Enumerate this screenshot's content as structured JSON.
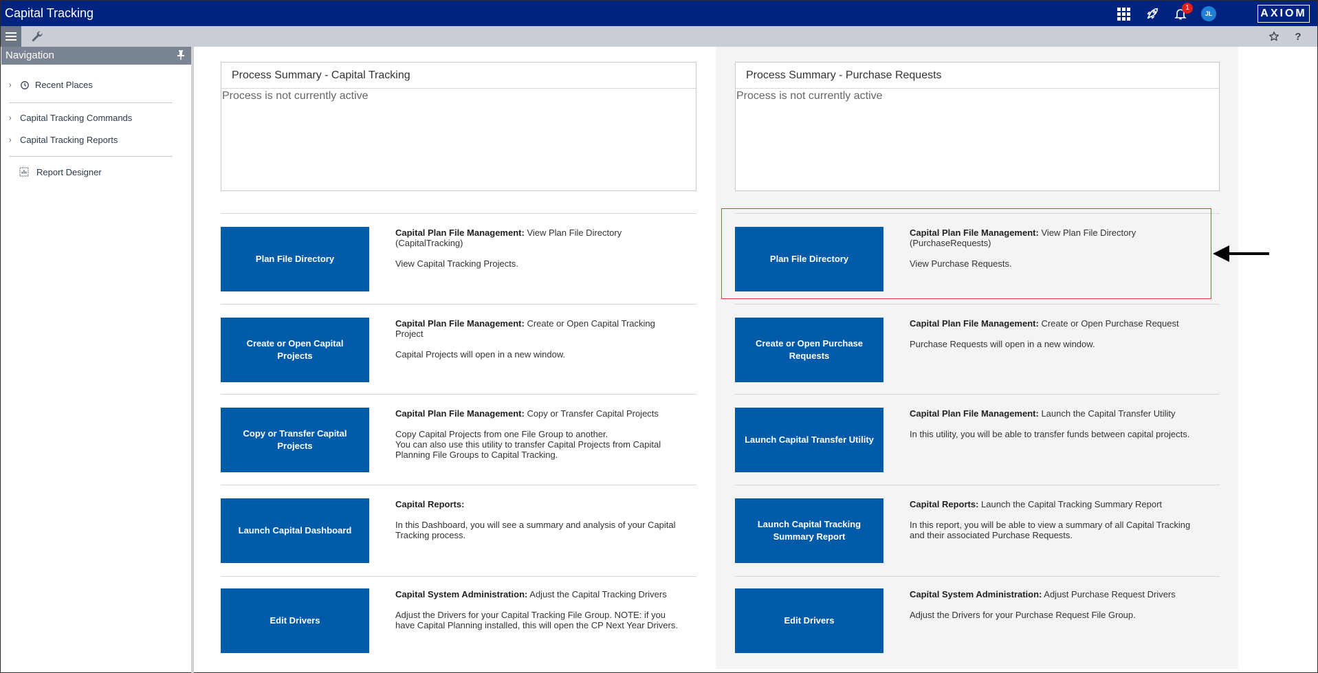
{
  "header": {
    "title": "Capital Tracking",
    "notification_count": "1",
    "avatar_initials": "JL",
    "logo": "AXIOM"
  },
  "toolbar": {
    "help_label": "?"
  },
  "sidebar": {
    "header": "Navigation",
    "items": [
      {
        "label": "Recent Places"
      },
      {
        "label": "Capital Tracking Commands"
      },
      {
        "label": "Capital Tracking Reports"
      },
      {
        "label": "Report Designer"
      }
    ]
  },
  "left": {
    "summary": {
      "title": "Process Summary - Capital Tracking",
      "status": "Process is not currently active"
    },
    "rows": [
      {
        "button": "Plan File Directory",
        "bold": "Capital Plan File Management:",
        "rest": " View Plan File Directory (CapitalTracking)",
        "body": "View Capital Tracking Projects.",
        "body2": ""
      },
      {
        "button": "Create or Open Capital Projects",
        "bold": "Capital Plan File Management:",
        "rest": " Create or Open Capital Tracking Project",
        "body": "Capital Projects will open in a new window.",
        "body2": ""
      },
      {
        "button": "Copy or Transfer Capital Projects",
        "bold": "Capital Plan File Management:",
        "rest": " Copy or Transfer Capital Projects",
        "body": "Copy Capital Projects from one File Group to another.",
        "body2": "You can also use this utility to transfer Capital Projects from Capital Planning File Groups to Capital Tracking."
      },
      {
        "button": "Launch Capital Dashboard",
        "bold": "Capital Reports:",
        "rest": "",
        "body": "In this Dashboard, you will see a summary and analysis of your Capital Tracking process.",
        "body2": ""
      },
      {
        "button": "Edit Drivers",
        "bold": "Capital System Administration:",
        "rest": " Adjust the Capital Tracking Drivers",
        "body": "Adjust the Drivers for your Capital Tracking File Group. NOTE: if you have Capital Planning installed, this will open the CP Next Year Drivers.",
        "body2": ""
      }
    ]
  },
  "right": {
    "summary": {
      "title": "Process Summary - Purchase Requests",
      "status": "Process is not currently active"
    },
    "rows": [
      {
        "button": "Plan File Directory",
        "bold": "Capital Plan File Management:",
        "rest": " View Plan File Directory (PurchaseRequests)",
        "body": "View Purchase Requests.",
        "body2": ""
      },
      {
        "button": "Create or Open Purchase Requests",
        "bold": "Capital Plan File Management:",
        "rest": " Create or Open Purchase Request",
        "body": "Purchase Requests will open in a new window.",
        "body2": ""
      },
      {
        "button": "Launch Capital Transfer Utility",
        "bold": "Capital Plan File Management:",
        "rest": " Launch the Capital Transfer Utility",
        "body": "In this utility, you will be able to transfer funds between capital projects.",
        "body2": ""
      },
      {
        "button": "Launch Capital Tracking Summary Report",
        "bold": "Capital Reports:",
        "rest": " Launch the Capital Tracking Summary Report",
        "body": "In this report, you will be able to view a summary of all Capital Tracking and their associated Purchase Requests.",
        "body2": ""
      },
      {
        "button": "Edit Drivers",
        "bold": "Capital System Administration:",
        "rest": " Adjust Purchase Request Drivers",
        "body": "Adjust the Drivers for your Purchase Request File Group.",
        "body2": ""
      }
    ]
  },
  "colors": {
    "header_bg": "#012380",
    "button_bg": "#015ba9",
    "highlight": "#e53935"
  }
}
